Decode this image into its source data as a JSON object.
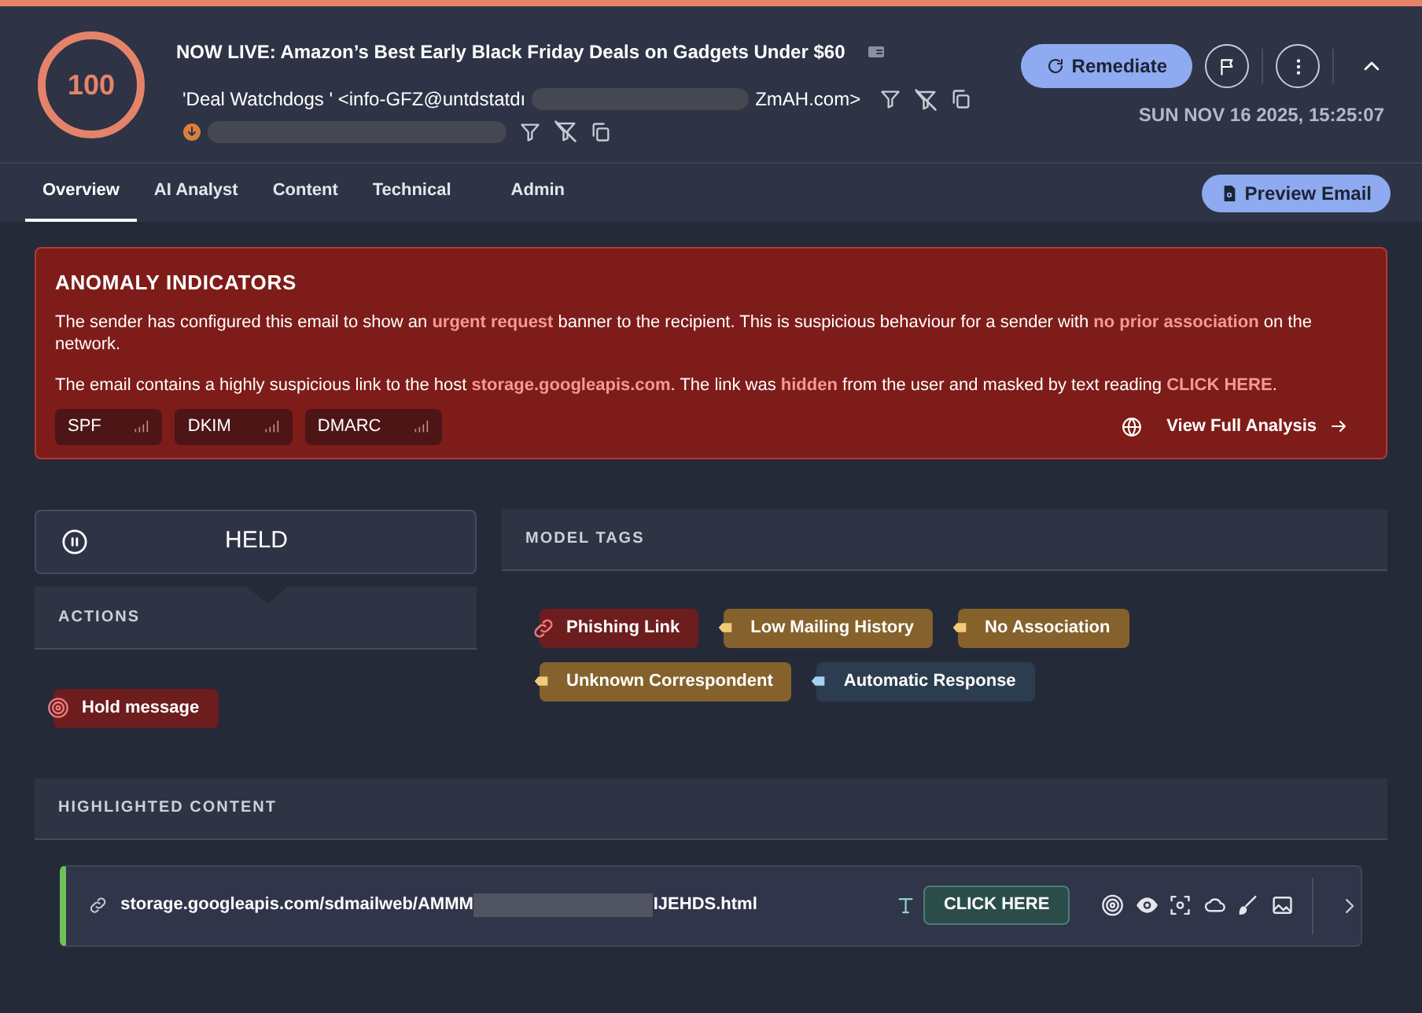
{
  "score": "100",
  "subject": "NOW LIVE: Amazon’s Best Early Black Friday Deals on Gadgets Under $60",
  "sender": {
    "start": "'Deal Watchdogs ' <info-GFZ@untdstatdı",
    "end": "ZmAH.com>"
  },
  "date": "SUN NOV 16 2025, 15:25:07",
  "remediate_button": "Remediate",
  "tabs": [
    {
      "label": "Overview",
      "selected": true
    },
    {
      "label": "AI Analyst",
      "selected": false
    },
    {
      "label": "Content",
      "selected": false
    },
    {
      "label": "Technical",
      "selected": false
    },
    {
      "label": "Admin",
      "selected": false
    }
  ],
  "preview_button": "Preview Email",
  "anomaly": {
    "title": "ANOMALY INDICATORS",
    "paragraphs": [
      "The sender has configured this email to show an **urgent request** banner to the recipient. This is suspicious behaviour for a sender with **no prior association** on the network.",
      "The email contains a highly suspicious link to the host **storage.googleapis.com**. The link was **hidden** from the user and masked by text reading **CLICK HERE**."
    ],
    "checks": [
      "SPF",
      "DKIM",
      "DMARC"
    ],
    "link": "View Full Analysis"
  },
  "status": "HELD",
  "actions": {
    "title": "ACTIONS",
    "items": [
      "Hold message"
    ]
  },
  "model_tags": {
    "title": "MODEL TAGS",
    "tags": [
      {
        "label": "Phishing Link",
        "kind": "link",
        "color": "#6e1d1f"
      },
      {
        "label": "Low Mailing History",
        "kind": "label",
        "color": "#85622c"
      },
      {
        "label": "No Association",
        "kind": "label",
        "color": "#85622c"
      },
      {
        "label": "Unknown Correspondent",
        "kind": "label",
        "color": "#85622c"
      },
      {
        "label": "Automatic Response",
        "kind": "label",
        "color": "#2c3d50"
      }
    ]
  },
  "highlighted": {
    "title": "HIGHLIGHTED CONTENT",
    "rows": [
      {
        "url_start": "storage.googleapis.com/sdmailweb/AMMM",
        "url_end": "IJEHDS.html",
        "text": "CLICK HERE"
      }
    ]
  }
}
